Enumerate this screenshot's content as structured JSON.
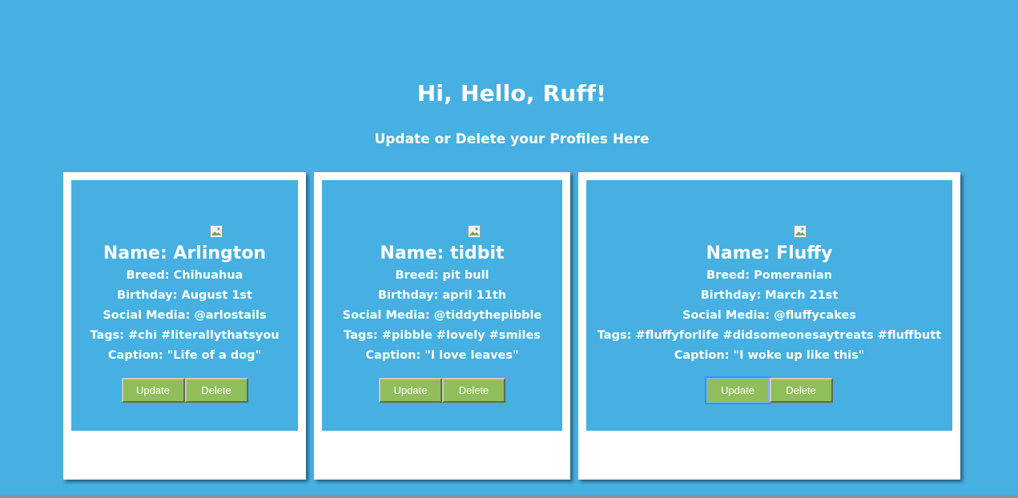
{
  "header": {
    "title": "Hi, Hello, Ruff!",
    "subtitle": "Update or Delete your Profiles Here"
  },
  "profiles": [
    {
      "name": "Name: Arlington",
      "breed": "Breed: Chihuahua",
      "birthday": "Birthday: August 1st",
      "social": "Social Media: @arlostails",
      "tags": "Tags: #chi #literallythatsyou",
      "caption": "Caption: \"Life of a dog\"",
      "update_label": "Update",
      "delete_label": "Delete"
    },
    {
      "name": "Name: tidbit",
      "breed": "Breed: pit bull",
      "birthday": "Birthday: april 11th",
      "social": "Social Media: @tiddythepibble",
      "tags": "Tags: #pibble #lovely #smiles",
      "caption": "Caption: \"I love leaves\"",
      "update_label": "Update",
      "delete_label": "Delete"
    },
    {
      "name": "Name: Fluffy",
      "breed": "Breed: Pomeranian",
      "birthday": "Birthday: March 21st",
      "social": "Social Media: @fluffycakes",
      "tags": "Tags: #fluffyforlife #didsomeonesaytreats #fluffbutt",
      "caption": "Caption: \"I woke up like this\"",
      "update_label": "Update",
      "delete_label": "Delete"
    }
  ],
  "colors": {
    "background": "#45b0e1",
    "card": "#ffffff",
    "button": "#8fbe5a",
    "text": "#ffffff"
  }
}
